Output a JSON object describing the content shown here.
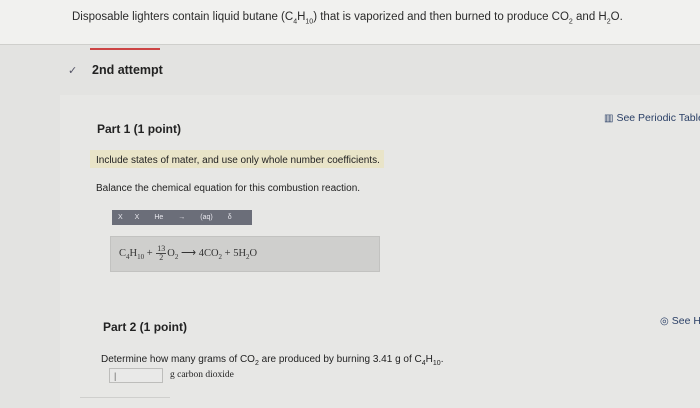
{
  "question": {
    "prefix": "Disposable lighters contain liquid butane (C",
    "sub1": "4",
    "mid1": "H",
    "sub2": "10",
    "mid2": ") that is vaporized and then burned to produce CO",
    "sub3": "2",
    "mid3": " and H",
    "sub4": "2",
    "suffix": "O."
  },
  "attempt": {
    "chevron": "✓",
    "label": "2nd attempt"
  },
  "part1": {
    "title": "Part 1   (1 point)",
    "periodic_link": "See Periodic Table",
    "periodic_icon": "bar-chart-icon",
    "hint": "Include states of mater, and use only whole number coefficients.",
    "instruction": "Balance the chemical equation for this combustion reaction.",
    "toolbar": [
      "X",
      "X",
      "He",
      "→",
      "(aq)",
      "δ"
    ],
    "equation": {
      "lhs1": "C",
      "lhs1_sub1": "4",
      "lhs1_mid": "H",
      "lhs1_sub2": "10",
      "plus1": " + ",
      "frac_num": "13",
      "frac_den": "2",
      "o2": "O",
      "o2_sub": "2",
      "arrow": " ⟶ ",
      "rhs1": "4CO",
      "rhs1_sub": "2",
      "plus2": " + ",
      "rhs2": "5H",
      "rhs2_sub": "2",
      "rhs2_end": "O"
    }
  },
  "part2": {
    "title": "Part 2   (1 point)",
    "hint_link": "See H",
    "hint_icon": "lightbulb-icon",
    "question_prefix": "Determine how many grams of CO",
    "question_sub1": "2",
    "question_mid": " are produced by burning 3.41 g of C",
    "question_sub2": "4",
    "question_mid2": "H",
    "question_sub3": "10",
    "question_end": ".",
    "answer_value": "|",
    "answer_unit": "g carbon dioxide"
  }
}
